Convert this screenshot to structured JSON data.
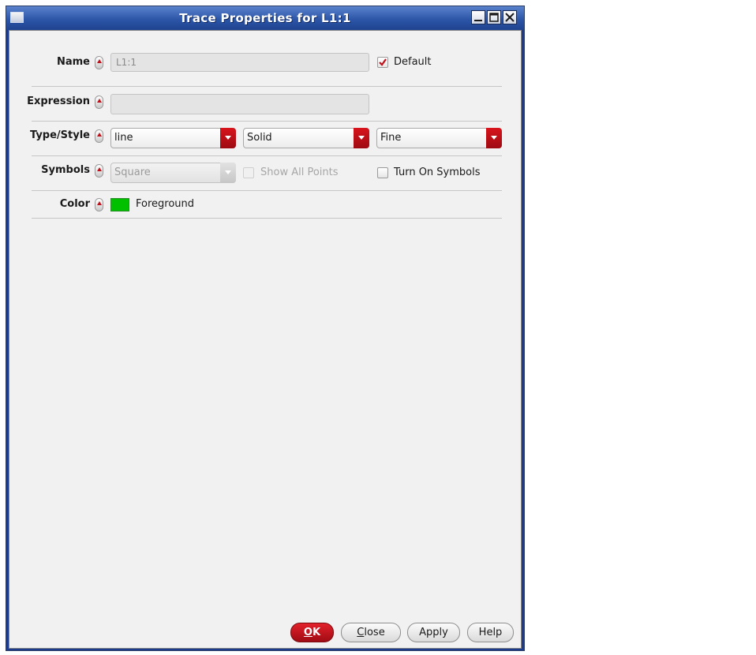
{
  "window": {
    "title": "Trace Properties for L1:1"
  },
  "form": {
    "name": {
      "label": "Name",
      "value": "L1:1",
      "default_checked": true,
      "default_label": "Default"
    },
    "expression": {
      "label": "Expression",
      "value": ""
    },
    "type_style": {
      "label": "Type/Style",
      "type": "line",
      "style": "Solid",
      "width": "Fine"
    },
    "symbols": {
      "label": "Symbols",
      "symbol": "Square",
      "show_all_points_label": "Show All Points",
      "show_all_points_checked": false,
      "turn_on_symbols_label": "Turn On Symbols",
      "turn_on_symbols_checked": false
    },
    "color": {
      "label": "Color",
      "swatch": "#00c000",
      "value": "Foreground"
    }
  },
  "buttons": {
    "ok_mnemonic": "O",
    "ok_rest": "K",
    "close_mnemonic": "C",
    "close_rest": "lose",
    "apply": "Apply",
    "help": "Help"
  }
}
